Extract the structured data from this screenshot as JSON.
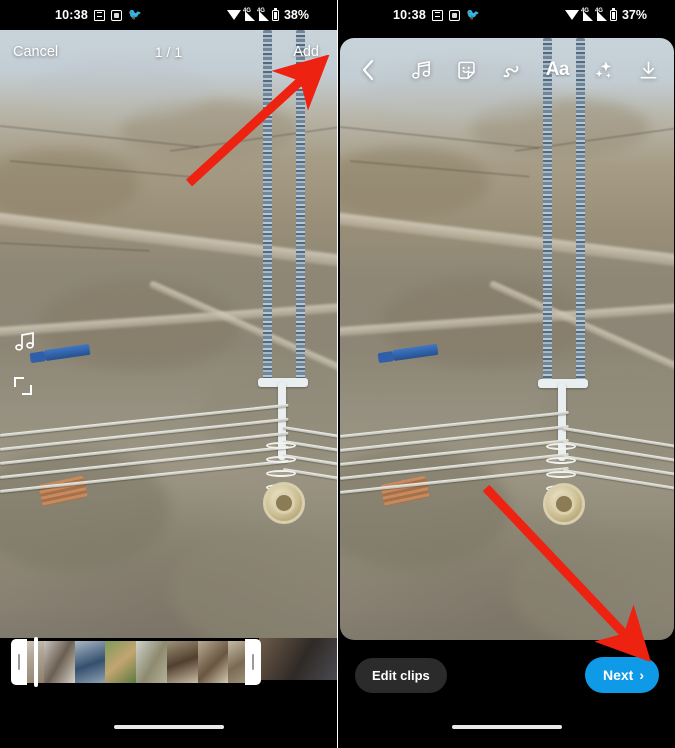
{
  "status_bar": {
    "time": "10:38",
    "left_icons": [
      "list-icon",
      "app-icon",
      "twitter-icon"
    ],
    "right_icons": [
      "wifi-icon",
      "signal-icon-1",
      "signal-icon-2",
      "battery-icon"
    ],
    "network_label": "4G",
    "battery_left": "38%",
    "battery_right": "37%"
  },
  "left_screen": {
    "header": {
      "cancel_label": "Cancel",
      "counter": "1 / 1",
      "add_label": "Add"
    },
    "overlay_icons": [
      "music-note-icon",
      "crop-icon"
    ],
    "timeline": {
      "handles": [
        "trim-start-handle",
        "trim-end-handle"
      ],
      "playhead": "playhead"
    },
    "annotation": "red-arrow-to-add"
  },
  "right_screen": {
    "toolbar": {
      "back_label": "back-chevron-icon",
      "tools": [
        {
          "name": "music-icon",
          "label": "Music"
        },
        {
          "name": "sticker-icon",
          "label": "Stickers"
        },
        {
          "name": "draw-icon",
          "label": "Draw"
        },
        {
          "name": "text-icon",
          "label": "Aa"
        },
        {
          "name": "effects-icon",
          "label": "Effects"
        },
        {
          "name": "download-icon",
          "label": "Save"
        }
      ]
    },
    "bottom": {
      "edit_clips_label": "Edit clips",
      "next_label": "Next",
      "next_chevron": "›"
    },
    "annotation": "red-arrow-to-next"
  },
  "colors": {
    "accent_blue": "#0f9ae8",
    "annotation_red": "#ee2211",
    "pill_dark": "#2b2b2b",
    "status_black": "#000000"
  }
}
